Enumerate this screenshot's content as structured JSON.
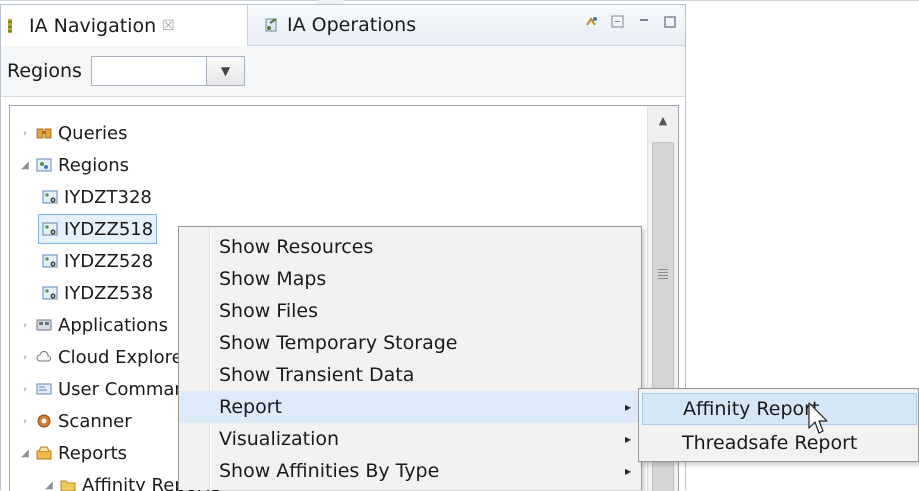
{
  "tabs": {
    "active_label": "IA Navigation",
    "close_glyph": "☒",
    "inactive_label": "IA Operations"
  },
  "filter": {
    "label": "Regions",
    "value": "",
    "dropdown_glyph": "▼"
  },
  "tree": [
    {
      "label": "Queries",
      "icon": "queries-icon",
      "level": 0,
      "expanded": false
    },
    {
      "label": "Regions",
      "icon": "regions-icon",
      "level": 0,
      "expanded": true
    },
    {
      "label": "IYDZT328",
      "icon": "region-icon",
      "level": 1
    },
    {
      "label": "IYDZZ518",
      "icon": "region-icon",
      "level": 1,
      "selected": true
    },
    {
      "label": "IYDZZ528",
      "icon": "region-icon",
      "level": 1
    },
    {
      "label": "IYDZZ538",
      "icon": "region-icon",
      "level": 1
    },
    {
      "label": "Applications",
      "icon": "applications-icon",
      "level": 0,
      "expanded": false
    },
    {
      "label": "Cloud Explorer",
      "icon": "cloud-icon",
      "level": 0,
      "expanded": false
    },
    {
      "label": "User Commands",
      "icon": "user-commands-icon",
      "level": 0,
      "expanded": false
    },
    {
      "label": "Scanner",
      "icon": "scanner-icon",
      "level": 0,
      "expanded": false
    },
    {
      "label": "Reports",
      "icon": "reports-icon",
      "level": 0,
      "expanded": true
    },
    {
      "label": "Affinity Reports",
      "icon": "folder-icon",
      "level": 1,
      "expanded": true
    }
  ],
  "context_menu": {
    "items": [
      {
        "label": "Show Resources"
      },
      {
        "label": "Show Maps"
      },
      {
        "label": "Show Files"
      },
      {
        "label": "Show Temporary Storage"
      },
      {
        "label": "Show Transient Data"
      },
      {
        "label": "Report",
        "submenu": true,
        "highlighted": true
      },
      {
        "label": "Visualization",
        "submenu": true
      },
      {
        "label": "Show Affinities By Type",
        "submenu": true
      }
    ],
    "submenu_arrow": "▸"
  },
  "report_submenu": {
    "items": [
      {
        "label": "Affinity Report",
        "highlighted": true
      },
      {
        "label": "Threadsafe Report"
      }
    ]
  },
  "colors": {
    "selection_border": "#7eb4ea",
    "selection_fill": "#e5f1fb",
    "menu_hover": "#ddeaf8",
    "watermark": "#e9ecf1"
  }
}
